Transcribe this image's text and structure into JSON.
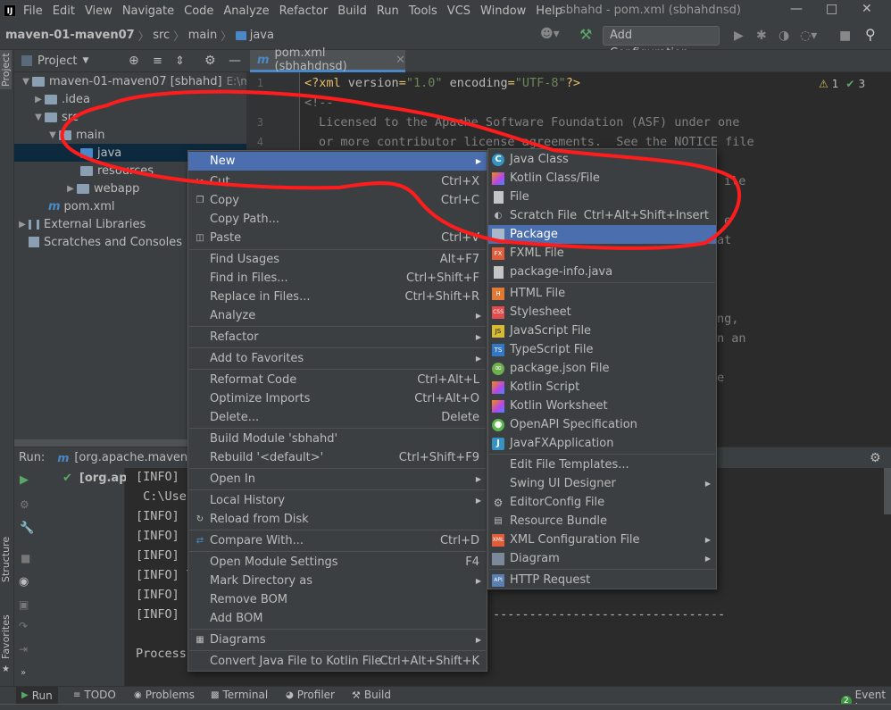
{
  "app_logo": "IJ",
  "menubar": [
    "File",
    "Edit",
    "View",
    "Navigate",
    "Code",
    "Analyze",
    "Refactor",
    "Build",
    "Run",
    "Tools",
    "VCS",
    "Window",
    "Help"
  ],
  "window_title": "sbhahd - pom.xml (sbhahdnsd)",
  "breadcrumbs": [
    "maven-01-maven07",
    "src",
    "main",
    "java"
  ],
  "toolbar": {
    "add_configuration": "Add Configuration..."
  },
  "project_panel": {
    "title": "Project",
    "tree": [
      {
        "label": "maven-01-maven07 [sbhahd]",
        "extra": "E:\\mave"
      },
      {
        "label": ".idea"
      },
      {
        "label": "src"
      },
      {
        "label": "main"
      },
      {
        "label": "java"
      },
      {
        "label": "resources"
      },
      {
        "label": "webapp"
      },
      {
        "label": "pom.xml"
      },
      {
        "label": "External Libraries"
      },
      {
        "label": "Scratches and Consoles"
      }
    ]
  },
  "editor": {
    "tab": "pom.xml (sbhahdnsd)",
    "warnings": "1",
    "checks": "3",
    "line_numbers": [
      "1",
      "2",
      "3",
      "4"
    ],
    "lines": [
      "<?xml version=\"1.0\" encoding=\"UTF-8\"?>",
      "<!--",
      "Licensed to the Apache Software Foundation (ASF) under one",
      "or more contributor license agreements.  See the NOTICE file"
    ],
    "right_fragments": [
      "ile",
      "e",
      "at",
      "ng,",
      "n an",
      "e"
    ]
  },
  "run_panel": {
    "label": "Run:",
    "tab": "[org.apache.maven.p",
    "tree_item": "[org.apa",
    "output": [
      "[INFO] [",
      " C:\\Use",
      "[INFO] [",
      "[INFO] [",
      "[INFO] [",
      "[INFO] T",
      "[INFO] [",
      "[INFO] [",
      "",
      "Process"
    ],
    "dashes": "--------------------------------"
  },
  "bottom_bar": [
    "Run",
    "TODO",
    "Problems",
    "Terminal",
    "Profiler",
    "Build"
  ],
  "event_log": {
    "count": "2",
    "label": "Event L"
  },
  "side_labels": {
    "project": "Project",
    "structure": "Structure",
    "favorites": "Favorites"
  },
  "context_menu": {
    "items": [
      {
        "label": "New",
        "shortcut": "",
        "submenu": true,
        "selected": true
      },
      {
        "label": "Cut",
        "shortcut": "Ctrl+X"
      },
      {
        "label": "Copy",
        "shortcut": "Ctrl+C"
      },
      {
        "label": "Copy Path...",
        "shortcut": ""
      },
      {
        "label": "Paste",
        "shortcut": "Ctrl+V"
      },
      {
        "label": "Find Usages",
        "shortcut": "Alt+F7"
      },
      {
        "label": "Find in Files...",
        "shortcut": "Ctrl+Shift+F"
      },
      {
        "label": "Replace in Files...",
        "shortcut": "Ctrl+Shift+R"
      },
      {
        "label": "Analyze",
        "shortcut": "",
        "submenu": true
      },
      {
        "label": "Refactor",
        "shortcut": "",
        "submenu": true
      },
      {
        "label": "Add to Favorites",
        "shortcut": "",
        "submenu": true
      },
      {
        "label": "Reformat Code",
        "shortcut": "Ctrl+Alt+L"
      },
      {
        "label": "Optimize Imports",
        "shortcut": "Ctrl+Alt+O"
      },
      {
        "label": "Delete...",
        "shortcut": "Delete"
      },
      {
        "label": "Build Module 'sbhahd'",
        "shortcut": ""
      },
      {
        "label": "Rebuild '<default>'",
        "shortcut": "Ctrl+Shift+F9"
      },
      {
        "label": "Open In",
        "shortcut": "",
        "submenu": true
      },
      {
        "label": "Local History",
        "shortcut": "",
        "submenu": true
      },
      {
        "label": "Reload from Disk",
        "shortcut": ""
      },
      {
        "label": "Compare With...",
        "shortcut": "Ctrl+D"
      },
      {
        "label": "Open Module Settings",
        "shortcut": "F4"
      },
      {
        "label": "Mark Directory as",
        "shortcut": "",
        "submenu": true
      },
      {
        "label": "Remove BOM",
        "shortcut": ""
      },
      {
        "label": "Add BOM",
        "shortcut": ""
      },
      {
        "label": "Diagrams",
        "shortcut": "",
        "submenu": true
      },
      {
        "label": "Convert Java File to Kotlin File",
        "shortcut": "Ctrl+Alt+Shift+K"
      }
    ]
  },
  "new_submenu": {
    "items": [
      {
        "label": "Java Class",
        "icon": "java-class-icon"
      },
      {
        "label": "Kotlin Class/File",
        "icon": "kotlin-icon"
      },
      {
        "label": "File",
        "icon": "file-icon"
      },
      {
        "label": "Scratch File",
        "shortcut": "Ctrl+Alt+Shift+Insert",
        "icon": "scratch-icon"
      },
      {
        "label": "Package",
        "icon": "package-icon",
        "selected": true
      },
      {
        "label": "FXML File",
        "icon": "fxml-icon"
      },
      {
        "label": "package-info.java",
        "icon": "java-file-icon"
      },
      {
        "label": "HTML File",
        "icon": "html-icon"
      },
      {
        "label": "Stylesheet",
        "icon": "css-icon"
      },
      {
        "label": "JavaScript File",
        "icon": "js-icon"
      },
      {
        "label": "TypeScript File",
        "icon": "ts-icon"
      },
      {
        "label": "package.json File",
        "icon": "json-icon"
      },
      {
        "label": "Kotlin Script",
        "icon": "kotlin-script-icon"
      },
      {
        "label": "Kotlin Worksheet",
        "icon": "kotlin-worksheet-icon"
      },
      {
        "label": "OpenAPI Specification",
        "icon": "openapi-icon"
      },
      {
        "label": "JavaFXApplication",
        "icon": "javafx-icon"
      },
      {
        "label": "Edit File Templates...",
        "icon": ""
      },
      {
        "label": "Swing UI Designer",
        "icon": "",
        "submenu": true
      },
      {
        "label": "EditorConfig File",
        "icon": "gear-icon"
      },
      {
        "label": "Resource Bundle",
        "icon": "bundle-icon"
      },
      {
        "label": "XML Configuration File",
        "icon": "xml-icon",
        "submenu": true
      },
      {
        "label": "Diagram",
        "icon": "diagram-icon",
        "submenu": true
      },
      {
        "label": "HTTP Request",
        "icon": "http-icon"
      }
    ]
  },
  "annotation_color": "#ff1c1c"
}
